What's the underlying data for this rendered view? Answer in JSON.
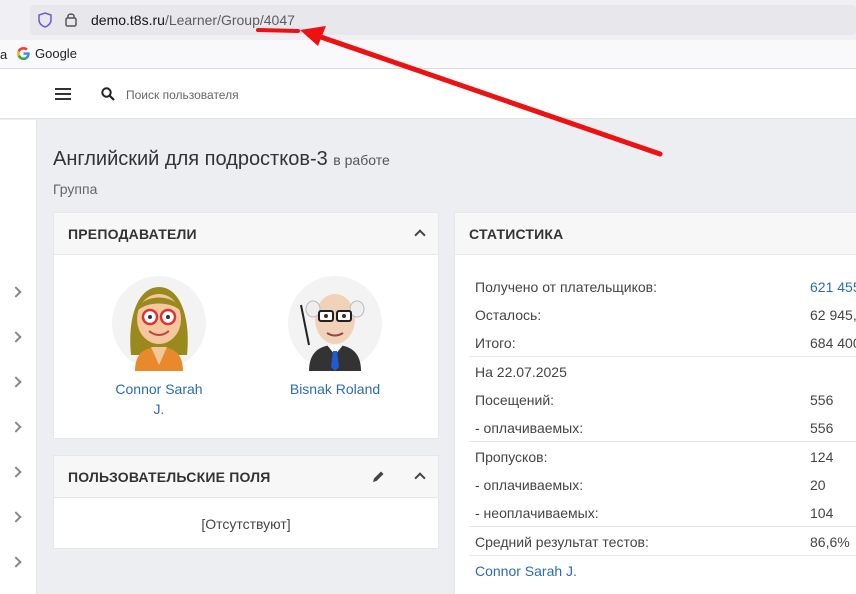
{
  "browser": {
    "url_host": "demo.t8s.ru",
    "url_path": "/Learner/Group/4047",
    "bookmarks_edge": "a",
    "bookmark_google": "Google"
  },
  "header": {
    "search_placeholder": "Поиск пользователя"
  },
  "page": {
    "title": "Английский для подростков-3",
    "status": "в работе",
    "subtitle": "Группа"
  },
  "teachers_panel": {
    "title": "ПРЕПОДАВАТЕЛИ",
    "teachers": [
      {
        "name_line1": "Connor Sarah",
        "name_line2": "J."
      },
      {
        "name_line1": "Bisnak Roland",
        "name_line2": ""
      }
    ]
  },
  "custom_fields_panel": {
    "title": "ПОЛЬЗОВАТЕЛЬСКИЕ ПОЛЯ",
    "empty_text": "[Отсутствуют]"
  },
  "stats_panel": {
    "title": "СТАТИСТИКА",
    "rows": [
      {
        "label": "Получено от плательщиков:",
        "value": "621 455"
      },
      {
        "label": "Осталось:",
        "value": "62 945,"
      },
      {
        "label": "Итого:",
        "value": "684 400"
      },
      {
        "label": "На 22.07.2025",
        "value": ""
      },
      {
        "label": "Посещений:",
        "value": "556"
      },
      {
        "label": "- оплачиваемых:",
        "value": "556"
      },
      {
        "label": "Пропусков:",
        "value": "124"
      },
      {
        "label": "- оплачиваемых:",
        "value": "20"
      },
      {
        "label": "- неоплачиваемых:",
        "value": "104"
      },
      {
        "label": "Средний результат тестов:",
        "value": "86,6%"
      },
      {
        "label": "Connor Sarah J.",
        "value": ""
      }
    ]
  },
  "colors": {
    "link": "#2a6db0",
    "annotation": "#ee1111"
  }
}
